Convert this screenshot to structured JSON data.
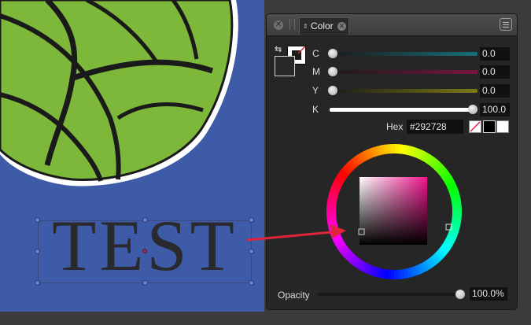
{
  "canvas": {
    "artwork_text": "TEST",
    "colors": {
      "artboard": "#3d5ba6",
      "ball": "#7db83a",
      "text": "#2a2a2e",
      "arrow": "#e0253a"
    }
  },
  "panel": {
    "tab_label": "Color",
    "tab_arrow_glyph": "⇕",
    "close_glyph": "✕",
    "swap_glyph": "⇆",
    "sliders": [
      {
        "label": "C",
        "value": "0.0",
        "level": 0.0,
        "color": "#14707a"
      },
      {
        "label": "M",
        "value": "0.0",
        "level": 0.0,
        "color": "#7a1440"
      },
      {
        "label": "Y",
        "value": "0.0",
        "level": 0.0,
        "color": "#7a7a14"
      },
      {
        "label": "K",
        "value": "100.0",
        "level": 1.0,
        "color": "#ffffff"
      }
    ],
    "hex_label": "Hex",
    "hex_value": "#292728",
    "opacity_label": "Opacity",
    "opacity_value": "100.0%",
    "opacity_level": 1.0,
    "fill_color": "#292728",
    "icons": [
      "close-icon",
      "grip-icon",
      "menu-icon",
      "swap-icon",
      "none-swatch-icon",
      "black-swatch-icon",
      "white-swatch-icon"
    ]
  }
}
